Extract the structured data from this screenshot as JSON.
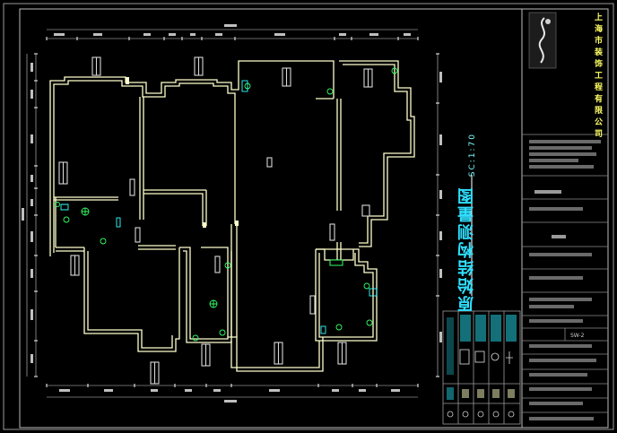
{
  "drawing": {
    "title": "原始结构测量图",
    "scale": "SC:1:70",
    "company": "上海市装饰工程有限公司",
    "drawing_number": "SW-2"
  },
  "colors": {
    "background": "#000000",
    "wall": "#ffffcc",
    "window": "#cfcfcf",
    "fixture_green": "#33ff66",
    "fixture_cyan": "#33ffff",
    "border": "#bdbdbd",
    "title_text": "#2fe0ff"
  }
}
